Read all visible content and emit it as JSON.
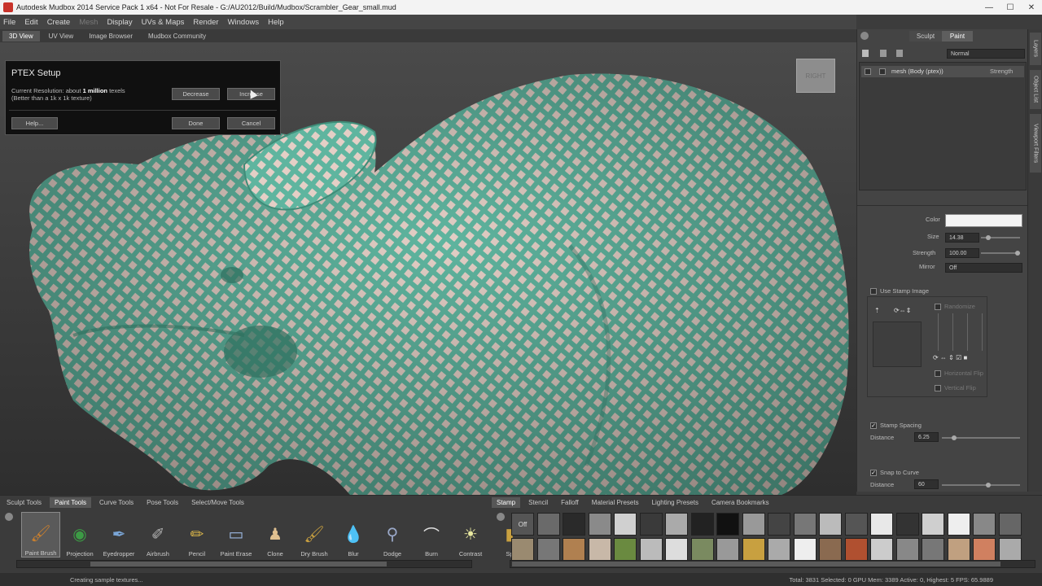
{
  "window": {
    "title": "Autodesk Mudbox 2014 Service Pack 1 x64 - Not For Resale - G:/AU2012/Build/Mudbox/Scrambler_Gear_small.mud",
    "minimize": "—",
    "maximize": "☐",
    "close": "✕"
  },
  "menu": [
    "File",
    "Edit",
    "Create",
    "Mesh",
    "Display",
    "UVs & Maps",
    "Render",
    "Windows",
    "Help"
  ],
  "view_tabs": [
    "3D View",
    "UV View",
    "Image Browser",
    "Mudbox Community"
  ],
  "ptex": {
    "title": "PTEX Setup",
    "resolution_prefix": "Current Resolution: about",
    "resolution_value": "1 million",
    "resolution_suffix": "texels",
    "resolution_note": "(Better than a 1k x 1k texture)",
    "decrease": "Decrease",
    "increase": "Increase",
    "help": "Help...",
    "done": "Done",
    "cancel": "Cancel"
  },
  "navcube": {
    "label": "RIGHT"
  },
  "right_panel": {
    "sculpt_tab": "Sculpt",
    "paint_tab": "Paint",
    "blend_mode": "Normal",
    "layer_name": "mesh (Body (ptex))",
    "layer_strength": "Strength",
    "color_label": "Color",
    "color_value": "#f4f4f4",
    "size_label": "Size",
    "size_value": "14.38",
    "strength_label": "Strength",
    "strength_value": "100.00",
    "mirror_label": "Mirror",
    "mirror_value": "Off",
    "use_stamp_image": "Use Stamp Image",
    "randomize": "Randomize",
    "horizontal_flip": "Horizontal Flip",
    "vertical_flip": "Vertical Flip",
    "stamp_spacing": "Stamp Spacing",
    "distance_label": "Distance",
    "stamp_distance": "6.25",
    "snap_to_curve": "Snap to Curve",
    "snap_distance": "60"
  },
  "side_tabs": [
    "Layers",
    "Object List",
    "Viewport Filters"
  ],
  "tool_tabs": [
    "Sculpt Tools",
    "Paint Tools",
    "Curve Tools",
    "Pose Tools",
    "Select/Move Tools"
  ],
  "tools": [
    {
      "label": "Paint Brush",
      "icon": "paint-brush-icon",
      "glyph": "🖌"
    },
    {
      "label": "Projection",
      "icon": "projection-icon",
      "glyph": "◉"
    },
    {
      "label": "Eyedropper",
      "icon": "eyedropper-icon",
      "glyph": "✒"
    },
    {
      "label": "Airbrush",
      "icon": "airbrush-icon",
      "glyph": "✐"
    },
    {
      "label": "Pencil",
      "icon": "pencil-icon",
      "glyph": "✏"
    },
    {
      "label": "Paint Erase",
      "icon": "eraser-icon",
      "glyph": "▭"
    },
    {
      "label": "Clone",
      "icon": "clone-icon",
      "glyph": "♟"
    },
    {
      "label": "Dry Brush",
      "icon": "dry-brush-icon",
      "glyph": "🖌"
    },
    {
      "label": "Blur",
      "icon": "blur-icon",
      "glyph": "💧"
    },
    {
      "label": "Dodge",
      "icon": "dodge-icon",
      "glyph": "⚲"
    },
    {
      "label": "Burn",
      "icon": "burn-icon",
      "glyph": "⌒"
    },
    {
      "label": "Contrast",
      "icon": "contrast-icon",
      "glyph": "☀"
    },
    {
      "label": "Sp",
      "icon": "sponge-icon",
      "glyph": "▮"
    }
  ],
  "stamp_tabs": [
    "Stamp",
    "Stencil",
    "Falloff",
    "Material Presets",
    "Lighting Presets",
    "Camera Bookmarks"
  ],
  "stamp_off": "Off",
  "status": {
    "left": "Creating sample textures...",
    "right": "Total: 3831  Selected: 0  GPU Mem: 3389  Active: 0, Highest: 5  FPS: 65.9889"
  }
}
